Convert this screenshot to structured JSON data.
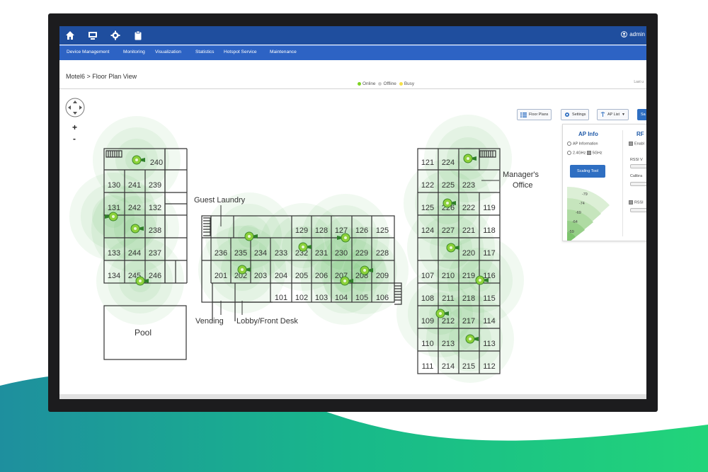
{
  "nav": {
    "icons": [
      "home-icon",
      "monitor-icon",
      "gear-icon",
      "clipboard-icon"
    ],
    "user_label": "admin"
  },
  "menu": [
    "Device Management",
    "Monitoring",
    "Visualization",
    "Statistics",
    "Hotspot Service",
    "Maintenance"
  ],
  "breadcrumb": "Motel6 > Floor Plan View",
  "legend": {
    "online": "Online",
    "offline": "Offline",
    "busy": "Busy",
    "colors": {
      "online": "#7ed321",
      "offline": "#cccccc",
      "busy": "#f5e04a"
    }
  },
  "last_label": "Last u",
  "toolbar": {
    "floor_plans": "Floor Plans",
    "settings": "Settings",
    "ap_list": "AP List",
    "save": "Sa"
  },
  "panel": {
    "ap_info_title": "AP Info",
    "ap_information": "AP Information",
    "band": "2.4GHz",
    "band_5g": "5GHz",
    "scaling_tool": "Scaling Tool",
    "rssi_values": [
      "-79",
      "-74",
      "-69",
      "-64",
      "-59"
    ],
    "rf_title": "RF",
    "rf_enable": "Enabl",
    "rf_rssi_w": "RSSI V",
    "rf_calib": "Calibra",
    "rf_rssi": "RSSI"
  },
  "floorplan": {
    "rooms": [
      "240",
      "130",
      "241",
      "239",
      "131",
      "242",
      "132",
      "238",
      "133",
      "244",
      "237",
      "134",
      "245",
      "246",
      "129",
      "128",
      "127",
      "126",
      "125",
      "236",
      "235",
      "234",
      "233",
      "232",
      "231",
      "230",
      "229",
      "228",
      "201",
      "202",
      "203",
      "204",
      "205",
      "206",
      "207",
      "208",
      "209",
      "101",
      "102",
      "103",
      "104",
      "105",
      "106",
      "121",
      "224",
      "122",
      "225",
      "223",
      "125",
      "226",
      "222",
      "119",
      "124",
      "227",
      "221",
      "118",
      "220",
      "117",
      "107",
      "210",
      "219",
      "116",
      "108",
      "211",
      "218",
      "115",
      "109",
      "212",
      "217",
      "114",
      "110",
      "213",
      "113",
      "111",
      "214",
      "215",
      "112"
    ],
    "labels": {
      "guest_laundry": "Guest Laundry",
      "managers_office_1": "Manager's",
      "managers_office_2": "Office",
      "pool": "Pool",
      "vending": "Vending",
      "lobby": "Lobby/Front Desk"
    }
  },
  "colors": {
    "nav_bar": "#1f4e9e",
    "menu_bar": "#2d63c4",
    "heat": "#3aa832",
    "ap_marker": "#8cd13a",
    "wave": "#1cc08a"
  }
}
